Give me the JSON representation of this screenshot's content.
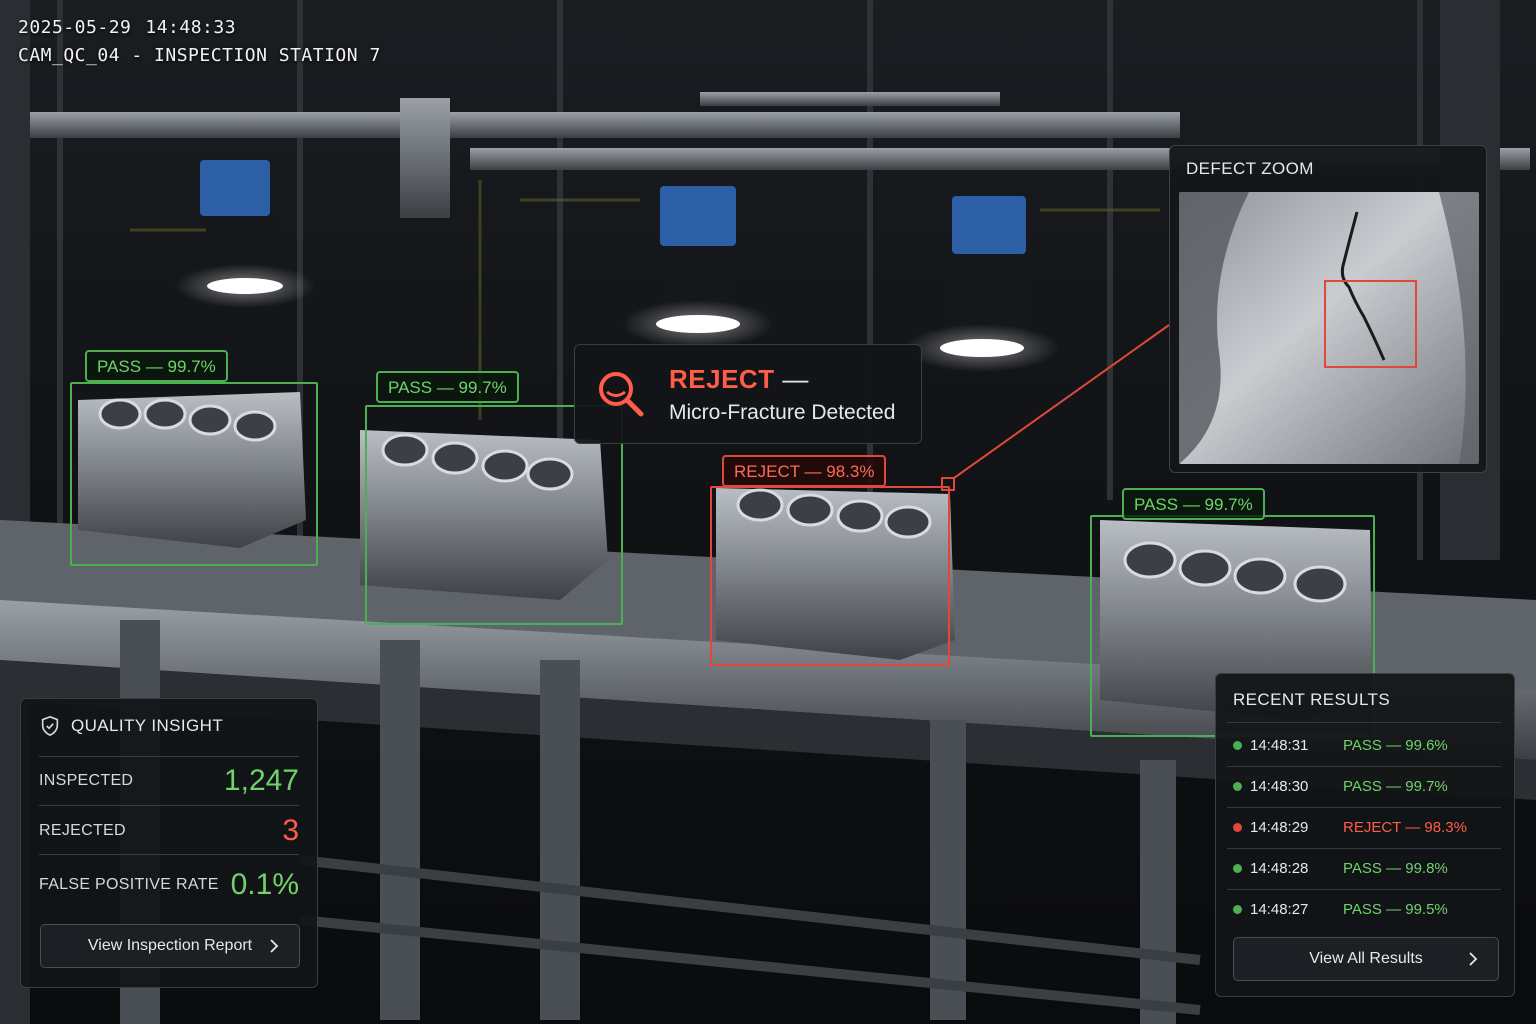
{
  "header": {
    "date": "2025-05-29",
    "time": "14:48:33",
    "camera": "CAM_QC_04 - INSPECTION STATION 7"
  },
  "detections": [
    {
      "status": "pass",
      "label": "PASS — 99.7%"
    },
    {
      "status": "pass",
      "label": "PASS — 99.7%"
    },
    {
      "status": "reject",
      "label": "REJECT — 98.3%"
    },
    {
      "status": "pass",
      "label": "PASS — 99.7%"
    }
  ],
  "callout": {
    "icon": "search-icon",
    "title": "REJECT",
    "dash": "—",
    "subtitle": "Micro-Fracture Detected"
  },
  "defect_zoom": {
    "title": "DEFECT ZOOM"
  },
  "quality_insight": {
    "icon": "shield-check-icon",
    "title": "QUALITY INSIGHT",
    "inspected_label": "INSPECTED",
    "inspected_value": "1,247",
    "rejected_label": "REJECTED",
    "rejected_value": "3",
    "fpr_label": "FALSE POSITIVE RATE",
    "fpr_value": "0.1%",
    "button_label": "View Inspection Report"
  },
  "recent_results": {
    "title": "RECENT RESULTS",
    "items": [
      {
        "time": "14:48:31",
        "result": "PASS — 99.6%",
        "status": "pass"
      },
      {
        "time": "14:48:30",
        "result": "PASS — 99.7%",
        "status": "pass"
      },
      {
        "time": "14:48:29",
        "result": "REJECT — 98.3%",
        "status": "reject"
      },
      {
        "time": "14:48:28",
        "result": "PASS — 99.8%",
        "status": "pass"
      },
      {
        "time": "14:48:27",
        "result": "PASS — 99.5%",
        "status": "pass"
      }
    ],
    "button_label": "View All Results"
  },
  "colors": {
    "pass": "#6fd36a",
    "reject": "#ff5d48",
    "box_pass": "#4caf50",
    "box_reject": "#e0493a"
  }
}
